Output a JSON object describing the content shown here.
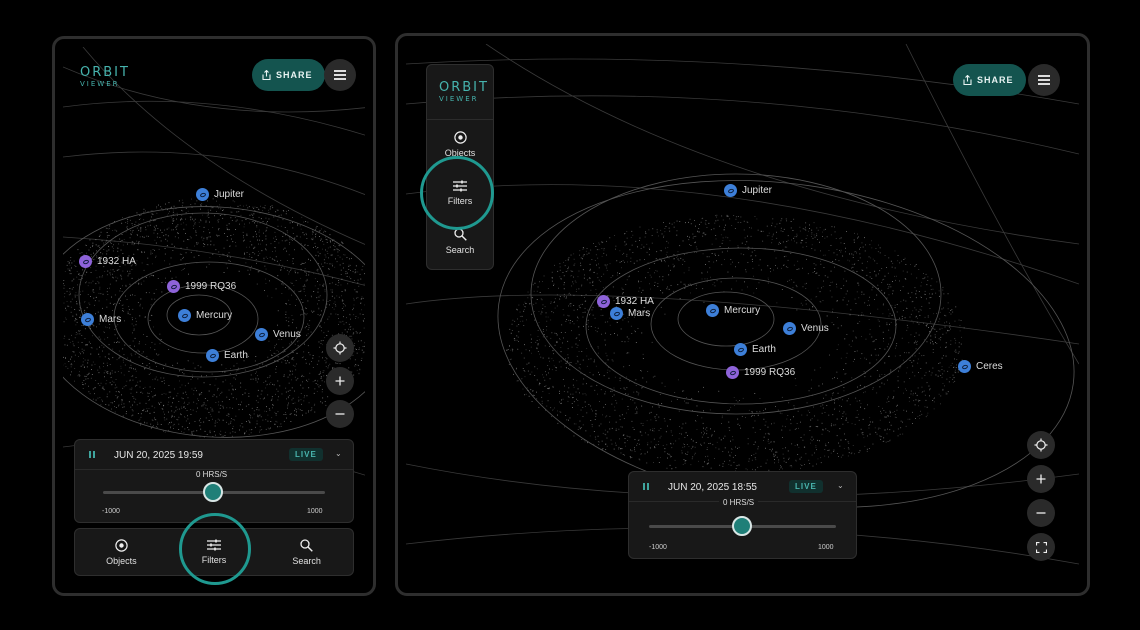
{
  "brand": {
    "line1": "ORBIT",
    "line2": "VIEWER"
  },
  "header": {
    "share_label": "SHARE"
  },
  "nav": {
    "objects": "Objects",
    "filters": "Filters",
    "search": "Search"
  },
  "phone_time": {
    "date": "JUN 20, 2025 19:59",
    "live": "LIVE",
    "rate": "0 HRS/S",
    "min": "-1000",
    "max": "1000"
  },
  "tablet_time": {
    "date": "JUN 20, 2025 18:55",
    "live": "LIVE",
    "rate": "0 HRS/S",
    "min": "-1000",
    "max": "1000"
  },
  "bodies": {
    "jupiter": "Jupiter",
    "hale": "1932 HA",
    "rq36": "1999 RQ36",
    "mars": "Mars",
    "mercury": "Mercury",
    "venus": "Venus",
    "earth": "Earth",
    "ceres": "Ceres"
  },
  "colors": {
    "accent": "#1f9990",
    "planet": "#3d7fd8",
    "asteroid": "#8e63d9",
    "share_bg": "#14544f"
  },
  "icons": [
    "hamburger-icon",
    "share-icon",
    "objects-icon",
    "filters-icon",
    "search-icon",
    "locate-icon",
    "plus-icon",
    "minus-icon",
    "fullscreen-icon",
    "pause-icon",
    "chevron-down-icon"
  ]
}
